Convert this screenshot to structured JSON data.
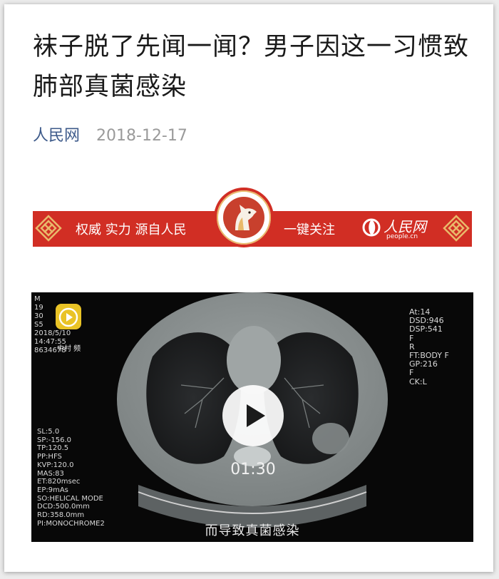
{
  "article": {
    "title": "袜子脱了先闻一闻？男子因这一习惯致肺部真菌感染",
    "source": "人民网",
    "date": "2018-12-17"
  },
  "banner": {
    "slogan": "权威 实力 源自人民",
    "follow": "一键关注",
    "logo_cn": "人民网",
    "logo_en": "people.cn",
    "colors": {
      "background": "#d12e24",
      "gold": "#e9b96a"
    }
  },
  "video": {
    "duration": "01:30",
    "caption": "而导致真菌感染",
    "app_label": "中村 频",
    "overlay_top_left": "M\n19\n30\nS5\n2018/5/10\n14:47:55\n8634678",
    "overlay_left": "SL:5.0\nSP:-156.0\nTP:120.5\nPP:HFS\nKVP:120.0\nMAS:83\nET:820msec\nEP:9mAs\nSO:HELICAL MODE\nDCD:500.0mm\nRD:358.0mm\nPI:MONOCHROME2",
    "overlay_right": "At:14\nDSD:946\nDSP:541\nF\nR\nFT:BODY F\nGP:216\nF\nCK:L"
  }
}
